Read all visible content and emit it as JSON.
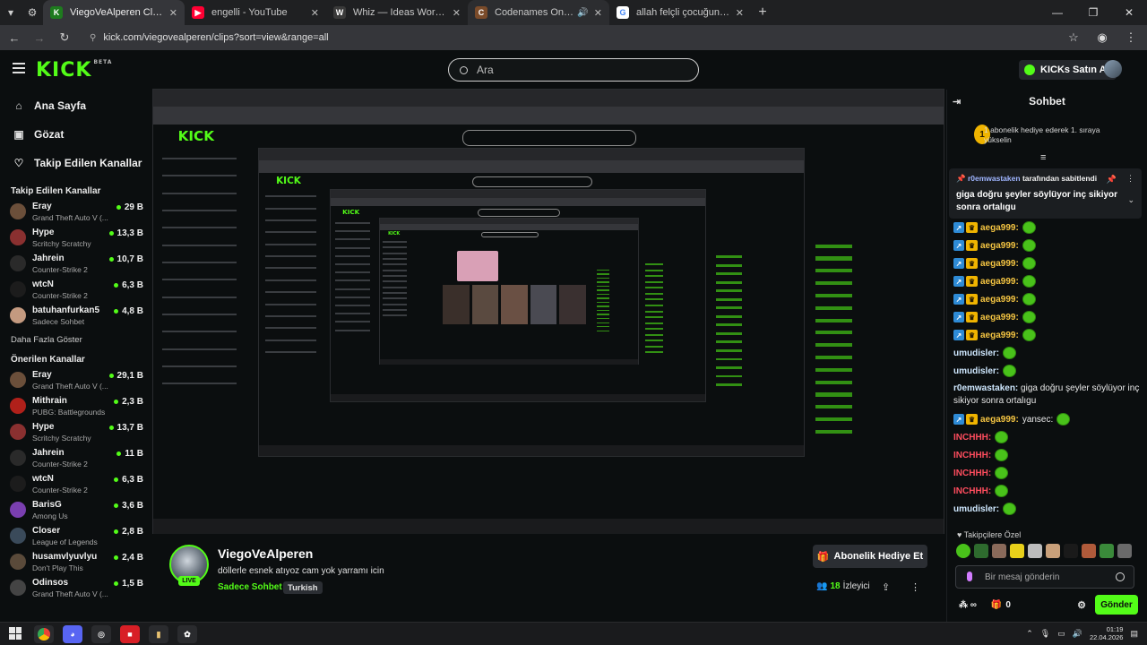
{
  "browser": {
    "tabs": [
      {
        "title": "ViegoVeAlperen Clips - Watch l",
        "icon": "kick-favicon",
        "active": true
      },
      {
        "title": "engelli - YouTube",
        "icon": "youtube-favicon",
        "active": false
      },
      {
        "title": "Whiz — Ideas Worth Sitting W",
        "icon": "whiz-favicon",
        "active": false
      },
      {
        "title": "Codenames Online",
        "icon": "codenames-favicon",
        "active": false,
        "audio": true
      },
      {
        "title": "allah felçli çocuğun dualarına c",
        "icon": "google-favicon",
        "active": false
      }
    ],
    "url": "kick.com/viegovealperen/clips?sort=view&range=all"
  },
  "header": {
    "logo": "KICK",
    "logo_badge": "BETA",
    "search_placeholder": "Ara",
    "kicks_button": "KICKs Satın Al"
  },
  "sidebar": {
    "nav": [
      {
        "label": "Ana Sayfa",
        "icon": "home-icon"
      },
      {
        "label": "Gözat",
        "icon": "browse-icon"
      },
      {
        "label": "Takip Edilen Kanallar",
        "icon": "heart-icon"
      }
    ],
    "followed_title": "Takip Edilen Kanallar",
    "followed": [
      {
        "name": "Eray",
        "game": "Grand Theft Auto V (...",
        "viewers": "29 B",
        "color": "#6b4f3a"
      },
      {
        "name": "Hype",
        "game": "Scritchy Scratchy",
        "viewers": "13,3 B",
        "color": "#8a3030"
      },
      {
        "name": "Jahrein",
        "game": "Counter-Strike 2",
        "viewers": "10,7 B",
        "color": "#2a2a2a"
      },
      {
        "name": "wtcN",
        "game": "Counter-Strike 2",
        "viewers": "6,3 B",
        "color": "#1c1c1c"
      },
      {
        "name": "batuhanfurkan5",
        "game": "Sadece Sohbet",
        "viewers": "4,8 B",
        "color": "#c49a80"
      }
    ],
    "more_label": "Daha Fazla Göster",
    "recommended_title": "Önerilen Kanallar",
    "recommended": [
      {
        "name": "Eray",
        "game": "Grand Theft Auto V (...",
        "viewers": "29,1 B",
        "color": "#6b4f3a"
      },
      {
        "name": "Mithrain",
        "game": "PUBG: Battlegrounds",
        "viewers": "2,3 B",
        "color": "#b0201a"
      },
      {
        "name": "Hype",
        "game": "Scritchy Scratchy",
        "viewers": "13,7 B",
        "color": "#8a3030"
      },
      {
        "name": "Jahrein",
        "game": "Counter-Strike 2",
        "viewers": "11 B",
        "color": "#2a2a2a"
      },
      {
        "name": "wtcN",
        "game": "Counter-Strike 2",
        "viewers": "6,3 B",
        "color": "#1c1c1c"
      },
      {
        "name": "BarisG",
        "game": "Among Us",
        "viewers": "3,6 B",
        "color": "#7a3fb0"
      },
      {
        "name": "Closer",
        "game": "League of Legends",
        "viewers": "2,8 B",
        "color": "#3a4a5a"
      },
      {
        "name": "husamvlyuvlyu",
        "game": "Don't Play This",
        "viewers": "2,4 B",
        "color": "#5a4a3a"
      },
      {
        "name": "Odinsos",
        "game": "Grand Theft Auto V (...",
        "viewers": "1,5 B",
        "color": "#444"
      }
    ]
  },
  "stream": {
    "streamer": "ViegoVeAlperen",
    "live": "LIVE",
    "title": "döllerle esnek atıyoz cam yok yarramı icin",
    "category": "Sadece Sohbet",
    "tag": "Turkish",
    "subscribe_gift": "Abonelik Hediye Et",
    "viewers": "18",
    "viewers_label": "İzleyici"
  },
  "chat": {
    "title": "Sohbet",
    "gift_rank": "1",
    "gift_text": "1 abonelik hediye ederek 1. sıraya yükselin",
    "pinned_by": "r0emwastaken",
    "pinned_suffix": "tarafından sabitlendi",
    "pinned_message": "giga doğru şeyler söylüyor inç sikiyor sonra ortalıgu",
    "messages": [
      {
        "user": "aega999:",
        "color": "#f5c542",
        "badges": true
      },
      {
        "user": "aega999:",
        "color": "#f5c542",
        "badges": true
      },
      {
        "user": "aega999:",
        "color": "#f5c542",
        "badges": true
      },
      {
        "user": "aega999:",
        "color": "#f5c542",
        "badges": true
      },
      {
        "user": "aega999:",
        "color": "#f5c542",
        "badges": true
      },
      {
        "user": "aega999:",
        "color": "#f5c542",
        "badges": true
      },
      {
        "user": "aega999:",
        "color": "#f5c542",
        "badges": true
      },
      {
        "user": "umudisler:",
        "color": "#cfe8ff",
        "badges": false
      },
      {
        "user": "umudisler:",
        "color": "#cfe8ff",
        "badges": false
      }
    ],
    "long_message": {
      "user": "r0emwastaken:",
      "text": "giga doğru şeyler söylüyor inç sikiyor sonra ortalıgu"
    },
    "yansec": {
      "user": "aega999:",
      "text": "yansec:"
    },
    "messages2": [
      {
        "user": "INCHHH:",
        "color": "#ff4d5e"
      },
      {
        "user": "INCHHH:",
        "color": "#ff4d5e"
      },
      {
        "user": "INCHHH:",
        "color": "#ff4d5e"
      },
      {
        "user": "INCHHH:",
        "color": "#ff4d5e"
      },
      {
        "user": "umudisler:",
        "color": "#cfe8ff"
      }
    ],
    "subs_emotes_title": "♥ Takipçilere Özel",
    "input_placeholder": "Bir mesaj gönderin",
    "kicks_count": "0",
    "send_label": "Gönder"
  },
  "taskbar": {
    "time": "01:19",
    "date": "22.04.2026"
  }
}
